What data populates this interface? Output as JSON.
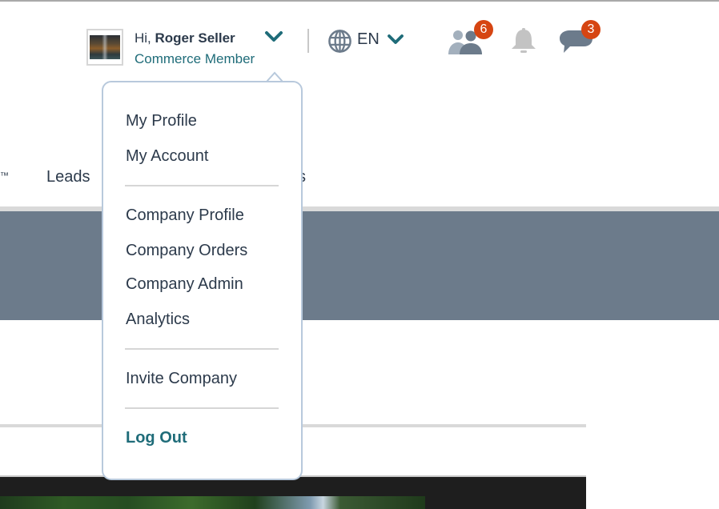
{
  "header": {
    "user": {
      "greeting_prefix": "Hi,",
      "name": "Roger Seller",
      "role": "Commerce Member",
      "avatar_icon": "avatar-photo"
    },
    "language": {
      "icon": "globe-icon",
      "code": "EN"
    },
    "notifications": {
      "connections_badge": "6",
      "alerts_badge": "",
      "messages_badge": "3"
    }
  },
  "nav": {
    "partial_trademark": "™",
    "leads_label": "Leads",
    "hidden_tail": "s"
  },
  "user_menu": {
    "groups": [
      [
        "My Profile",
        "My Account"
      ],
      [
        "Company Profile",
        "Company Orders",
        "Company Admin",
        "Analytics"
      ],
      [
        "Invite Company"
      ]
    ],
    "logout_label": "Log Out"
  },
  "colors": {
    "accent_teal": "#1f6c79",
    "badge_orange": "#d64512",
    "banner_slate": "#6c7b8b",
    "text_dark": "#2c3a4b"
  }
}
